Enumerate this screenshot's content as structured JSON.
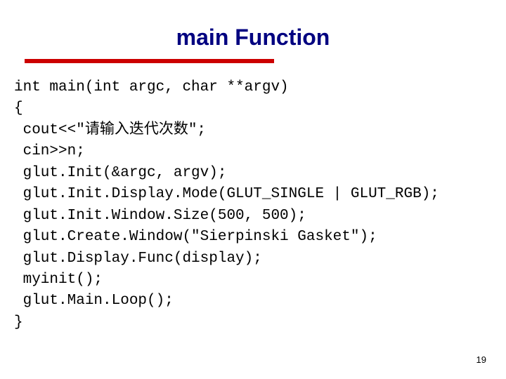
{
  "title": "main Function",
  "code_lines": [
    "int main(int argc, char **argv)",
    "{",
    " cout<<\"请输入迭代次数\";",
    " cin>>n;",
    " glut.Init(&argc, argv);",
    " glut.Init.Display.Mode(GLUT_SINGLE | GLUT_RGB);",
    " glut.Init.Window.Size(500, 500);",
    " glut.Create.Window(\"Sierpinski Gasket\");",
    " glut.Display.Func(display);",
    " myinit();",
    " glut.Main.Loop();",
    "}"
  ],
  "page_number": "19"
}
